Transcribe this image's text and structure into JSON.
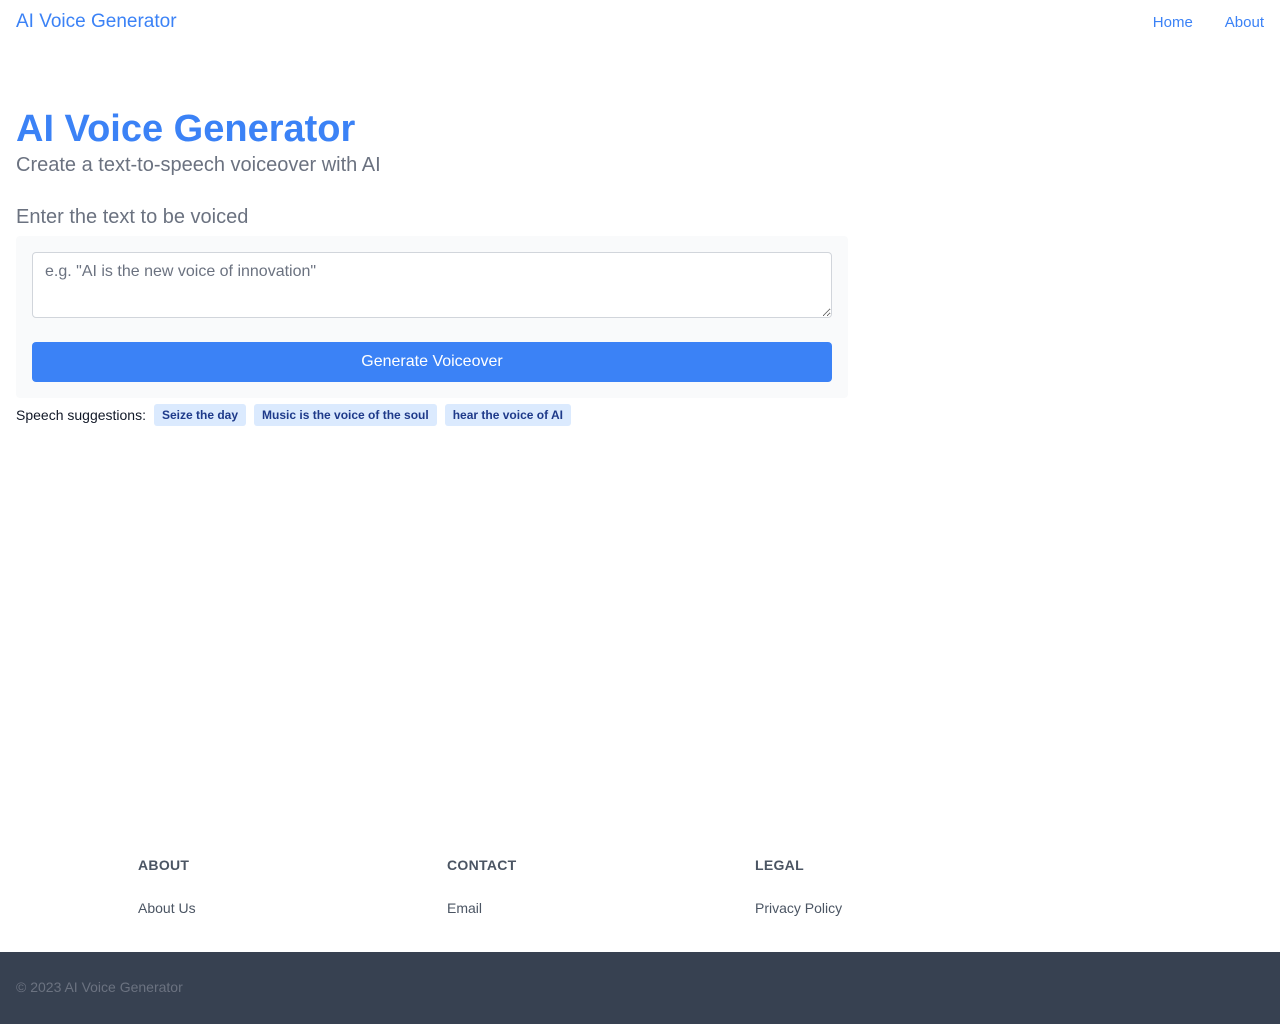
{
  "header": {
    "brand": "AI Voice Generator",
    "nav": [
      {
        "label": "Home"
      },
      {
        "label": "About"
      }
    ]
  },
  "hero": {
    "title": "AI Voice Generator",
    "subtitle": "Create a text-to-speech voiceover with AI"
  },
  "form": {
    "label": "Enter the text to be voiced",
    "input_value": "",
    "input_placeholder": "e.g. \"AI is the new voice of innovation\"",
    "submit_label": "Generate Voiceover"
  },
  "suggestions": {
    "label": "Speech suggestions:",
    "items": [
      "Seize the day",
      "Music is the voice of the soul",
      "hear the voice of AI"
    ]
  },
  "footer": {
    "columns": [
      {
        "heading": "ABOUT",
        "link": "About Us"
      },
      {
        "heading": "CONTACT",
        "link": "Email"
      },
      {
        "heading": "LEGAL",
        "link": "Privacy Policy"
      }
    ],
    "copyright": "© 2023 AI Voice Generator"
  },
  "colors": {
    "accent": "#3b82f6",
    "chip_bg": "#dbeafe",
    "chip_text": "#1e3a8a",
    "footer_bg": "#374151"
  }
}
